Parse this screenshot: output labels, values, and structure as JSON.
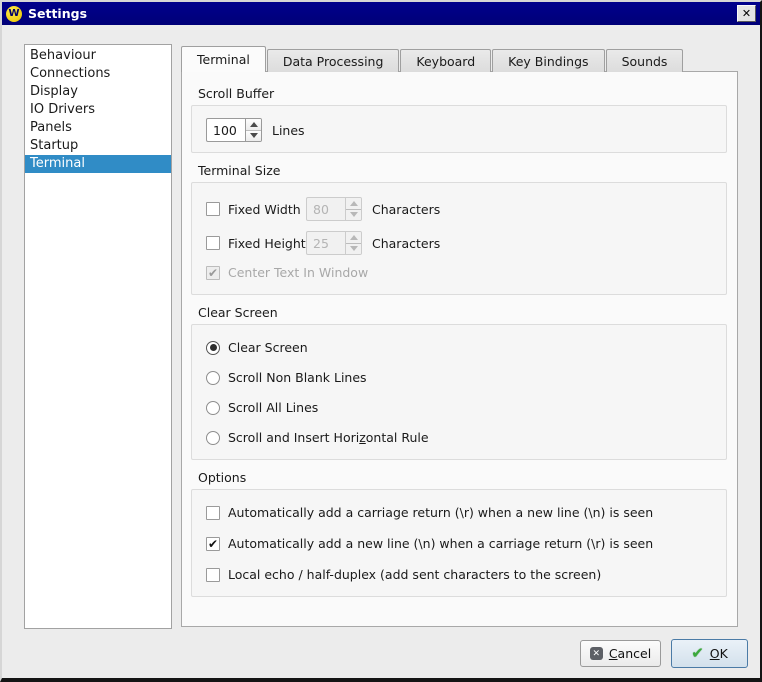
{
  "window": {
    "title": "Settings"
  },
  "icons": {
    "app": "W",
    "close": "✕",
    "check": "✔",
    "cancel_glyph": "✕",
    "ok_glyph": "✔"
  },
  "colors": {
    "titlebar": "#000080",
    "highlight": "#308cc6",
    "window_bg": "#ececec",
    "pane_bg": "#fafafa",
    "ok_border": "#4b7ba6",
    "ok_check_green": "#3ba93b"
  },
  "sidebar": {
    "items": [
      {
        "label": "Behaviour",
        "selected": false
      },
      {
        "label": "Connections",
        "selected": false
      },
      {
        "label": "Display",
        "selected": false
      },
      {
        "label": "IO Drivers",
        "selected": false
      },
      {
        "label": "Panels",
        "selected": false
      },
      {
        "label": "Startup",
        "selected": false
      },
      {
        "label": "Terminal",
        "selected": true
      }
    ]
  },
  "tabs": [
    {
      "label": "Terminal",
      "active": true
    },
    {
      "label": "Data Processing",
      "active": false
    },
    {
      "label": "Keyboard",
      "active": false
    },
    {
      "label": "Key Bindings",
      "active": false
    },
    {
      "label": "Sounds",
      "active": false
    }
  ],
  "scroll_buffer": {
    "title": "Scroll Buffer",
    "value": "100",
    "unit": "Lines"
  },
  "terminal_size": {
    "title": "Terminal Size",
    "fixed_width": {
      "label": "Fixed Width",
      "checked": false,
      "value": "80",
      "unit": "Characters"
    },
    "fixed_height": {
      "label": "Fixed Height",
      "checked": false,
      "value": "25",
      "unit": "Characters"
    },
    "center_text": {
      "label": "Center Text In Window",
      "checked": true,
      "disabled": true
    }
  },
  "clear_screen": {
    "title": "Clear Screen",
    "option1": {
      "label": "Clear Screen",
      "selected": true
    },
    "option2": {
      "label": "Scroll Non Blank Lines",
      "selected": false
    },
    "option3": {
      "label": "Scroll All Lines",
      "selected": false
    },
    "option4": {
      "pre": "Scroll and Insert Hori",
      "key": "z",
      "post": "ontal Rule",
      "selected": false
    }
  },
  "options": {
    "title": "Options",
    "item1": {
      "label": "Automatically add a carriage return (\\r) when a new line (\\n) is seen",
      "checked": false
    },
    "item2": {
      "label": "Automatically add a new line (\\n) when a carriage return (\\r) is seen",
      "checked": true
    },
    "item3": {
      "label": "Local echo / half-duplex (add sent characters to the screen)",
      "checked": false
    }
  },
  "buttons": {
    "cancel": {
      "pre": "",
      "key": "C",
      "post": "ancel"
    },
    "ok": {
      "pre": "",
      "key": "O",
      "post": "K"
    }
  }
}
